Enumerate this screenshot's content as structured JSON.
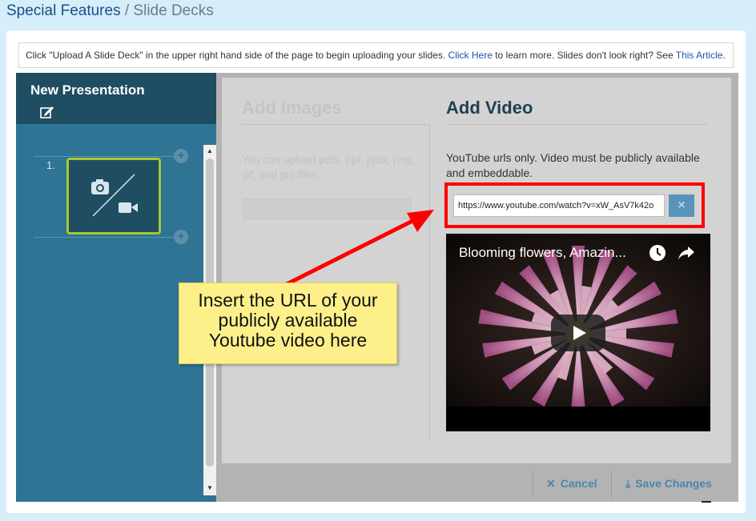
{
  "breadcrumb": {
    "section": "Special Features",
    "separator": "/",
    "page": "Slide Decks"
  },
  "notice": {
    "text_before": "Click \"Upload A Slide Deck\" in the upper right hand side of the page to begin uploading your slides. ",
    "link1": "Click Here",
    "text_middle": " to learn more. Slides don't look right? See ",
    "link2": "This Article",
    "text_after": "."
  },
  "sidebar": {
    "presentation_title": "New Presentation",
    "slides": [
      {
        "number": "1."
      }
    ],
    "accent_color": "#a6c832"
  },
  "add_images": {
    "title": "Add Images",
    "description": "You can upload pdfs, ppt, pptx, png, gif, and jpg files.",
    "upload_button": "Upload file from Computer"
  },
  "add_video": {
    "title": "Add Video",
    "description": "YouTube urls only. Video must be publicly available and embeddable.",
    "url_value": "https://www.youtube.com/watch?v=xW_AsV7k42o",
    "clear_button": "×",
    "video_title": "Blooming flowers, Amazin..."
  },
  "footer": {
    "cancel": "Cancel",
    "save": "Save Changes"
  },
  "callout": {
    "line1": "Insert the URL of your",
    "line2": "publicly available",
    "line3": "Youtube video here"
  },
  "colors": {
    "highlight": "#ff0000",
    "callout_bg": "#fdf08a",
    "sidebar_bg": "#2f7494",
    "link": "#1a56a8"
  }
}
